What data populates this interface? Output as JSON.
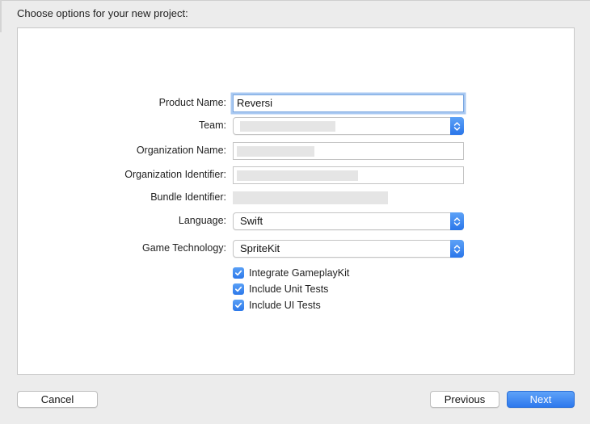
{
  "dialog": {
    "heading": "Choose options for your new project:"
  },
  "form": {
    "product_name": {
      "label": "Product Name:",
      "value": "Reversi"
    },
    "team": {
      "label": "Team:"
    },
    "organization_name": {
      "label": "Organization Name:"
    },
    "organization_identifier": {
      "label": "Organization Identifier:"
    },
    "bundle_identifier": {
      "label": "Bundle Identifier:"
    },
    "language": {
      "label": "Language:",
      "value": "Swift"
    },
    "game_technology": {
      "label": "Game Technology:",
      "value": "SpriteKit"
    },
    "checkboxes": [
      {
        "label": "Integrate GameplayKit",
        "checked": true
      },
      {
        "label": "Include Unit Tests",
        "checked": true
      },
      {
        "label": "Include UI Tests",
        "checked": true
      }
    ]
  },
  "buttons": {
    "cancel": "Cancel",
    "previous": "Previous",
    "next": "Next"
  },
  "colors": {
    "accent": "#2d78ed",
    "focus_ring": "#a9c9f2"
  },
  "icons": {
    "popup_stepper": "chevron-up-down-icon",
    "checkmark": "checkmark-icon"
  }
}
